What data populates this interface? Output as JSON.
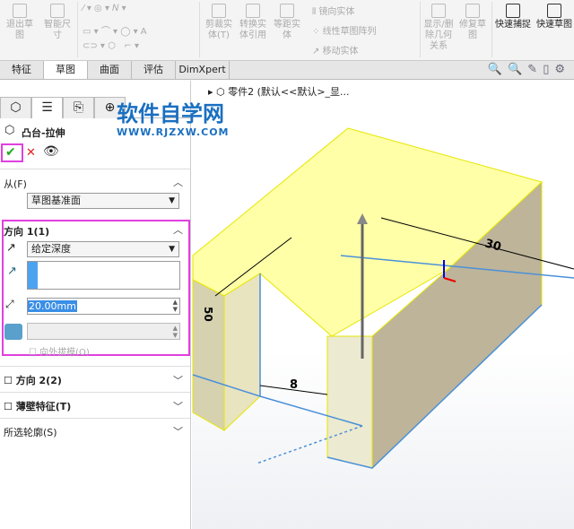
{
  "ribbon": {
    "exit_sketch": "退出草图",
    "smart_dim": "智能尺寸",
    "trim": "剪裁实体(T)",
    "convert": "转换实体引用",
    "offset": "等距实体",
    "mirror": "镜向实体",
    "linear_pattern": "线性草图阵列",
    "move": "移动实体",
    "relations": "显示/删除几何关系",
    "repair": "修复草图",
    "quick_snap": "快速捕捉",
    "rapid_sketch": "快速草图"
  },
  "tabs": [
    "特征",
    "草图",
    "曲面",
    "评估",
    "DimXpert"
  ],
  "panel": {
    "feature_title": "凸台-拉伸",
    "from_label": "从(F)",
    "from_value": "草图基准面",
    "dir1_label": "方向 1(1)",
    "dir1_type": "给定深度",
    "depth_value": "20.00mm",
    "draft_label": "向外拔模(O)",
    "dir2_label": "方向 2(2)",
    "thin_label": "薄壁特征(T)",
    "contours_label": "所选轮廓(S)"
  },
  "viewport": {
    "breadcrumb": "零件2  (默认<<默认>_显...",
    "dims": [
      "30",
      "8",
      "50"
    ]
  },
  "watermark": {
    "title": "软件自学网",
    "url": "WWW.RJZXW.COM"
  },
  "colors": {
    "accent": "#e040e0",
    "face": "#ffff99",
    "edge": "#4a90d9"
  }
}
